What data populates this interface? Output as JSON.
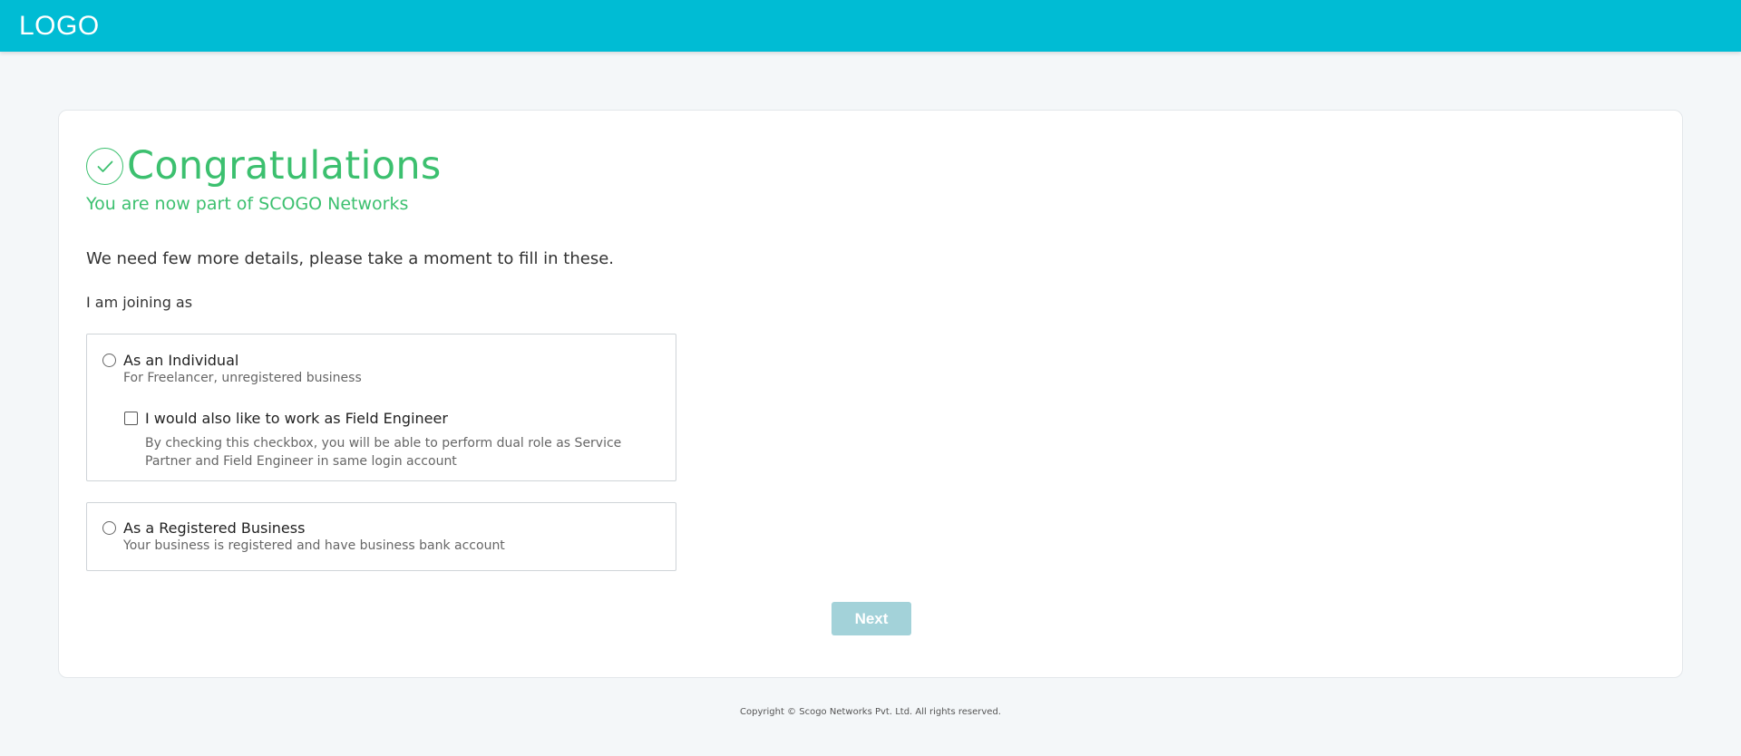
{
  "header": {
    "logo": "LOGO",
    "bg_color": "#00bcd4"
  },
  "card": {
    "success_icon": "check-circle-icon",
    "title": "Congratulations",
    "subtitle": "You are now part of SCOGO Networks",
    "intro": "We need few more details, please take a moment to fill in these.",
    "joining_label": "I am joining as",
    "accent_color": "#3cc06f",
    "options": [
      {
        "title": "As an Individual",
        "description": "For Freelancer, unregistered business",
        "selected": false,
        "checkbox": {
          "label": "I would also like to work as Field Engineer",
          "description": "By checking this checkbox, you will be able to perform dual role as Service Partner and Field Engineer in same login account",
          "checked": false
        }
      },
      {
        "title": "As a Registered Business",
        "description": "Your business is registered and have business bank account",
        "selected": false
      }
    ],
    "next_label": "Next",
    "next_color": "#a3d2d9"
  },
  "footer": {
    "copyright": "Copyright © Scogo Networks Pvt. Ltd. All rights reserved."
  }
}
